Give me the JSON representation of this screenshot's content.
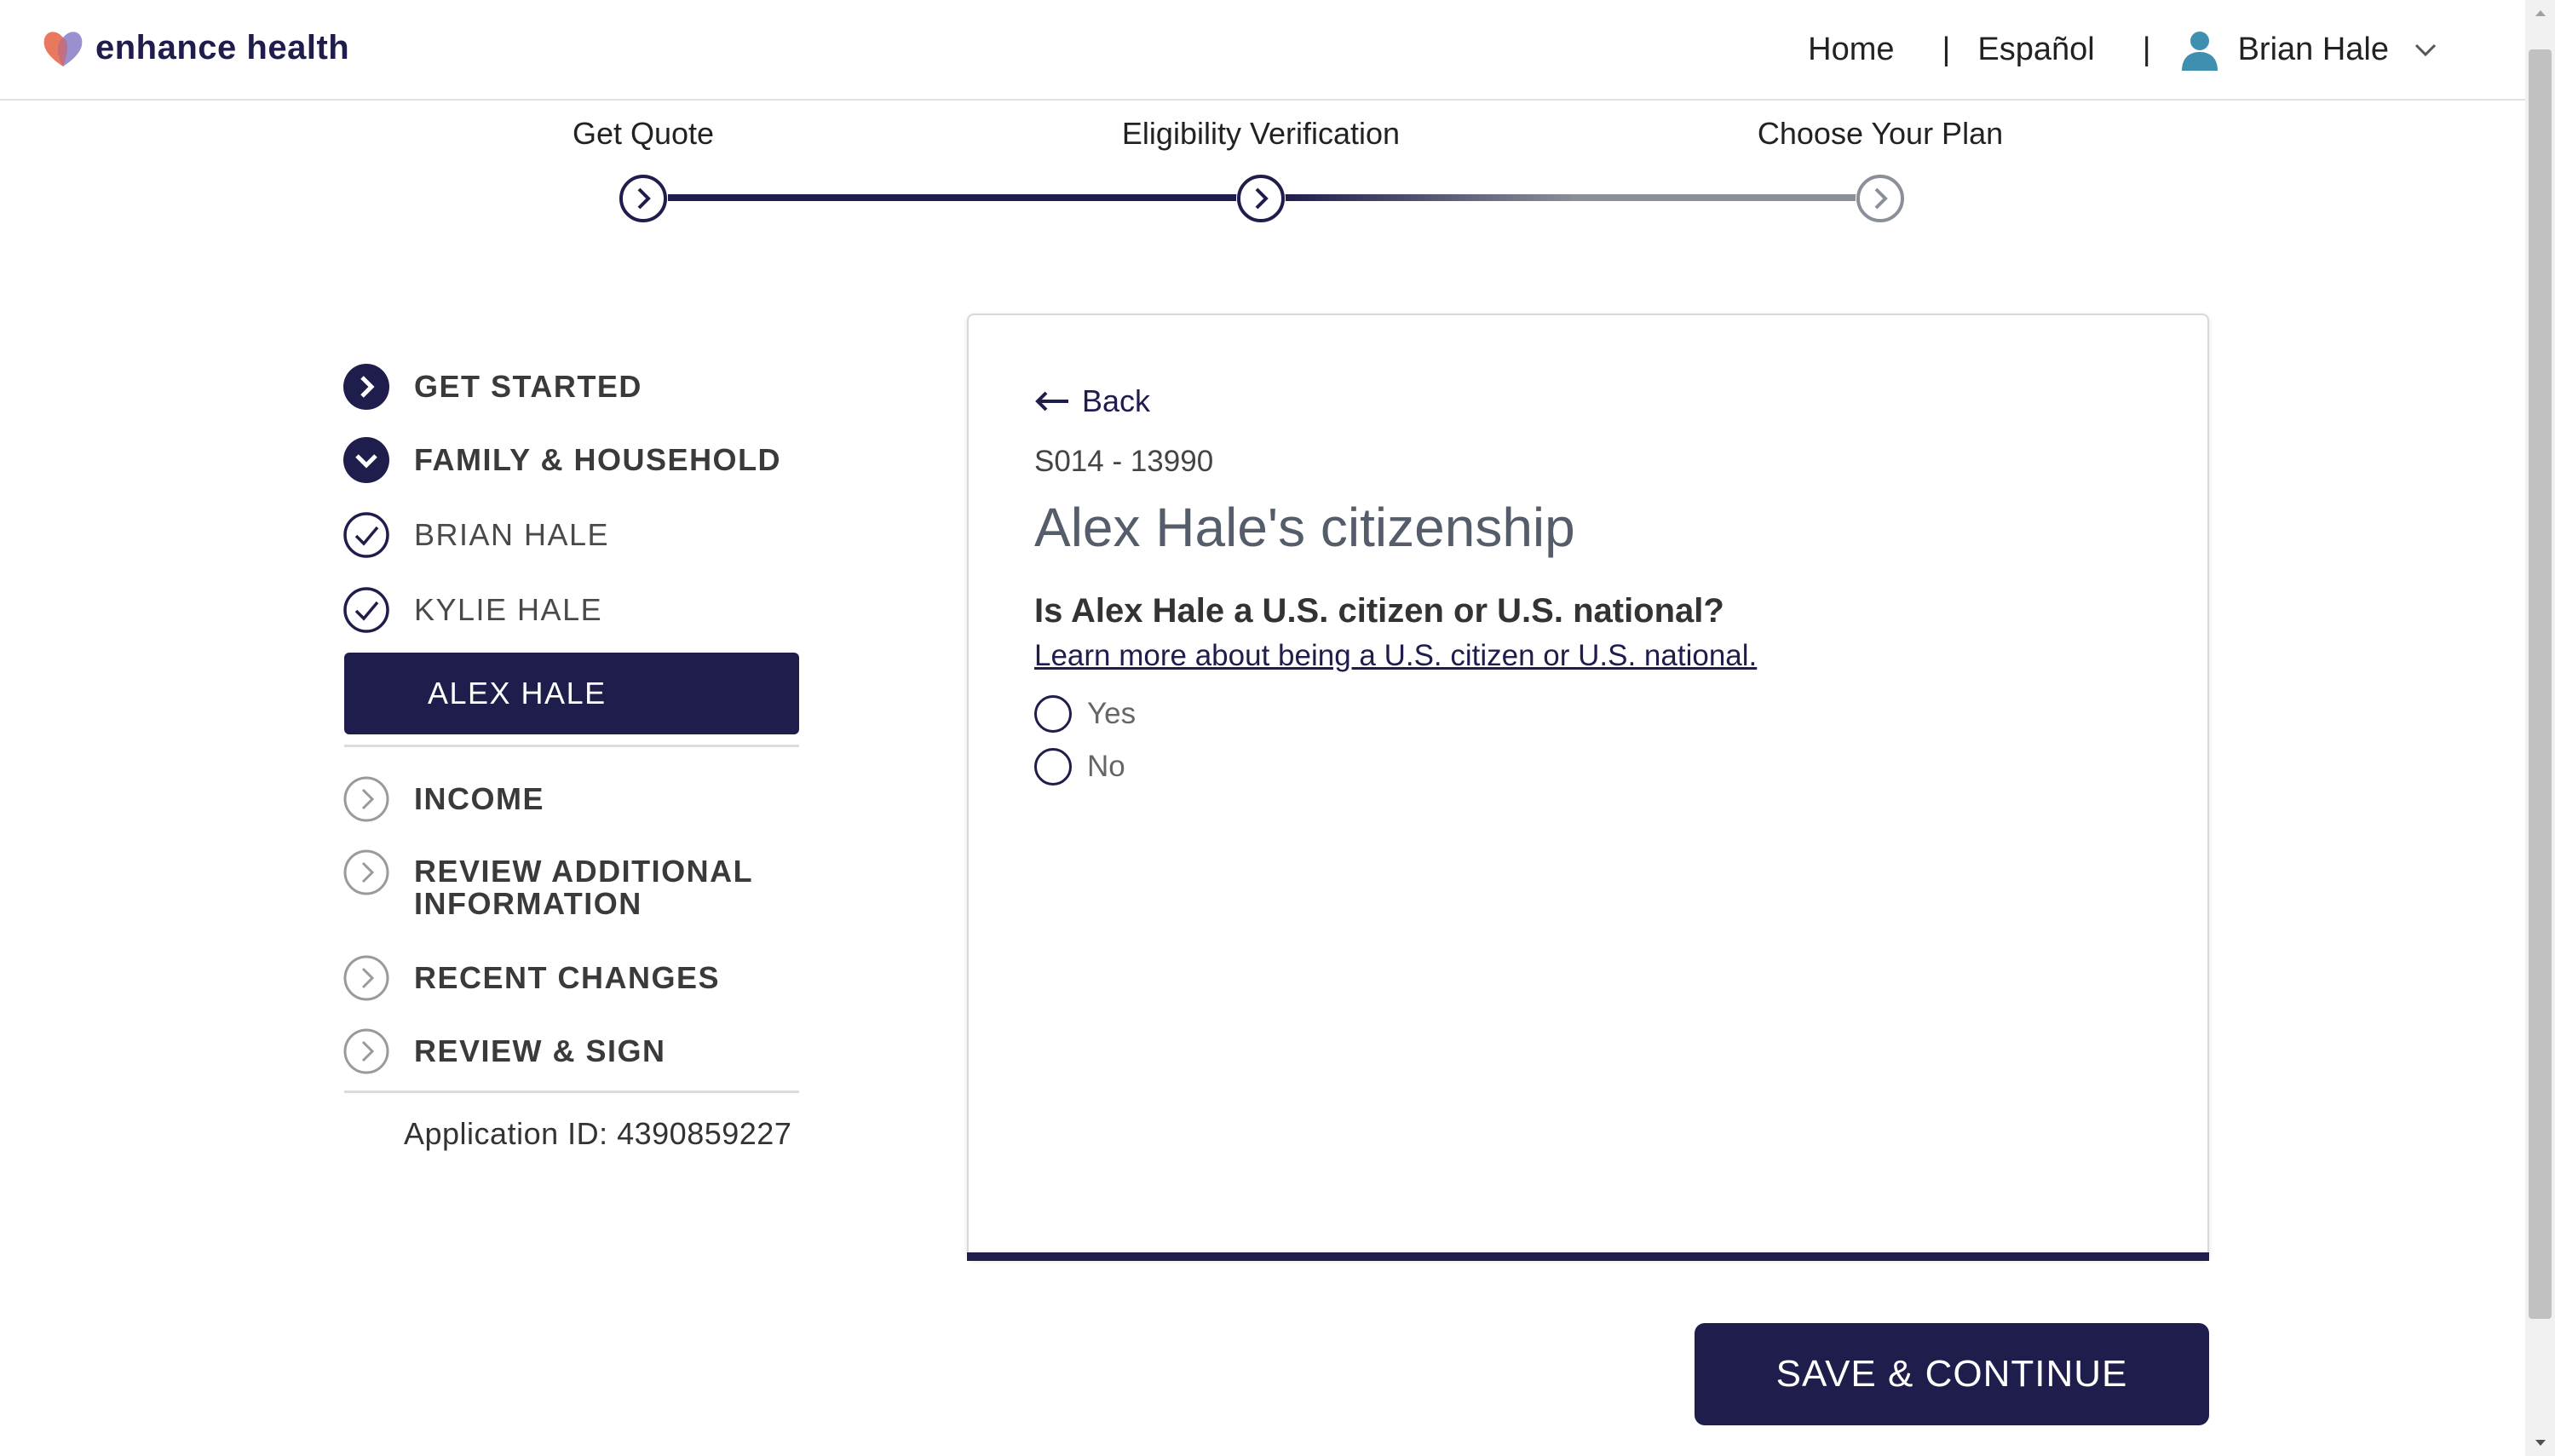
{
  "header": {
    "logo_text": "enhance health",
    "nav": {
      "home": "Home",
      "spanish": "Español",
      "user_name": "Brian Hale"
    },
    "separator": "|"
  },
  "progress": {
    "steps": [
      {
        "label": "Get Quote",
        "status": "complete"
      },
      {
        "label": "Eligibility Verification",
        "status": "current"
      },
      {
        "label": "Choose Your Plan",
        "status": "upcoming"
      }
    ]
  },
  "sidebar": {
    "items": [
      {
        "label": "GET STARTED",
        "status": "complete"
      },
      {
        "label": "FAMILY & HOUSEHOLD",
        "status": "expanded"
      },
      {
        "label": "BRIAN HALE",
        "status": "checked"
      },
      {
        "label": "KYLIE HALE",
        "status": "checked"
      },
      {
        "label": "ALEX HALE",
        "status": "active"
      },
      {
        "label": "INCOME",
        "status": "upcoming"
      },
      {
        "label": "REVIEW ADDITIONAL INFORMATION",
        "status": "upcoming"
      },
      {
        "label": "RECENT CHANGES",
        "status": "upcoming"
      },
      {
        "label": "REVIEW & SIGN",
        "status": "upcoming"
      }
    ],
    "application_id": "Application ID: 4390859227"
  },
  "main": {
    "back_label": "Back",
    "code": "S014 - 13990",
    "title": "Alex Hale's citizenship",
    "question": "Is Alex Hale a U.S. citizen or U.S. national?",
    "learn_more": "Learn more about being a U.S. citizen or U.S. national.",
    "options": [
      "Yes",
      "No"
    ]
  },
  "actions": {
    "save_continue": "SAVE & CONTINUE"
  },
  "colors": {
    "primary": "#1f1d4c",
    "grey": "#8a8f99",
    "logo_orange": "#e8795f",
    "logo_purple": "#8f84c9",
    "user_icon": "#3e8fb0"
  }
}
